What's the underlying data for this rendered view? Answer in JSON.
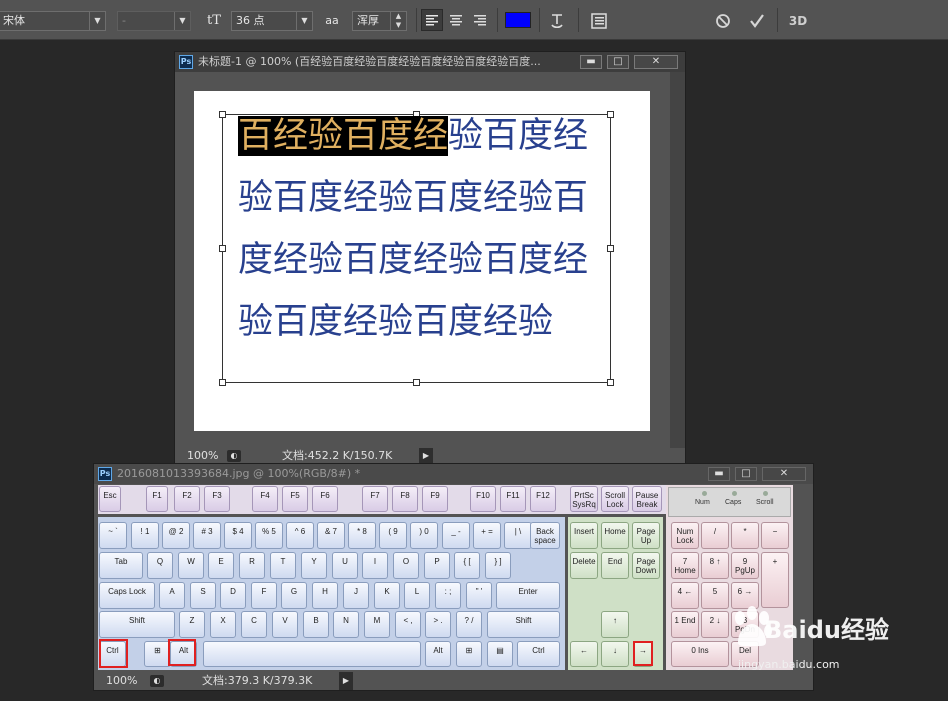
{
  "options_bar": {
    "font_family": "宋体",
    "font_style": "-",
    "size_icon": "tT",
    "font_size": "36 点",
    "aa_icon": "aa",
    "antialias": "浑厚",
    "text_color": "#0000ff",
    "icons": [
      "align-left-icon",
      "align-center-icon",
      "align-right-icon",
      "warp-text-icon",
      "panels-icon",
      "cancel-icon",
      "commit-icon",
      "3d-icon"
    ],
    "label_3d": "3D"
  },
  "doc1": {
    "title": "未标题-1 @ 100% (百经验百度经验百度经验百度经验百度经验百度...",
    "minimize": "▬",
    "maximize": "□",
    "close": "✕",
    "text_selected": "百经验百度经",
    "lines": [
      "验百度经",
      "验百度经验百度经验百",
      "度经验百度经验百度经",
      "验百度经验百度经验"
    ],
    "text_color": "#28408e",
    "selection_color": "#e0b060",
    "zoom": "100%",
    "doc_info": "文档:452.2 K/150.7K"
  },
  "doc2": {
    "title": "2016081013393684.jpg @ 100%(RGB/8#) *",
    "zoom": "100%",
    "doc_info": "文档:379.3 K/379.3K"
  },
  "keyboard": {
    "keys": [
      [
        "Esc",
        "f"
      ],
      [
        "F1",
        "f"
      ],
      [
        "F2",
        "f"
      ],
      [
        "F3",
        "f"
      ],
      [
        "F4",
        "f"
      ],
      [
        "F5",
        "f"
      ],
      [
        "F6",
        "f"
      ],
      [
        "F7",
        "f"
      ],
      [
        "F8",
        "f"
      ],
      [
        "F9",
        "f"
      ],
      [
        "F10",
        "f"
      ],
      [
        "F11",
        "f"
      ],
      [
        "F12",
        "f"
      ],
      [
        "PrtSc SysRq",
        "f"
      ],
      [
        "Scroll Lock",
        "f"
      ],
      [
        "Pause Break",
        "f"
      ],
      [
        "~ `",
        ""
      ],
      [
        "! 1",
        ""
      ],
      [
        "@ 2",
        ""
      ],
      [
        "# 3",
        ""
      ],
      [
        "$ 4",
        ""
      ],
      [
        "% 5",
        ""
      ],
      [
        "^ 6",
        ""
      ],
      [
        "& 7",
        ""
      ],
      [
        "* 8",
        ""
      ],
      [
        "( 9",
        ""
      ],
      [
        ") 0",
        ""
      ],
      [
        "_ -",
        ""
      ],
      [
        "+ =",
        ""
      ],
      [
        "| \\",
        ""
      ],
      [
        "Back space",
        ""
      ],
      [
        "Tab",
        ""
      ],
      [
        "Q",
        ""
      ],
      [
        "W",
        ""
      ],
      [
        "E",
        ""
      ],
      [
        "R",
        ""
      ],
      [
        "T",
        ""
      ],
      [
        "Y",
        ""
      ],
      [
        "U",
        ""
      ],
      [
        "I",
        ""
      ],
      [
        "O",
        ""
      ],
      [
        "P",
        ""
      ],
      [
        "{ [",
        ""
      ],
      [
        "} ]",
        ""
      ],
      [
        "Caps Lock",
        ""
      ],
      [
        "A",
        ""
      ],
      [
        "S",
        ""
      ],
      [
        "D",
        ""
      ],
      [
        "F",
        ""
      ],
      [
        "G",
        ""
      ],
      [
        "H",
        ""
      ],
      [
        "J",
        ""
      ],
      [
        "K",
        ""
      ],
      [
        "L",
        ""
      ],
      [
        ": ;",
        ""
      ],
      [
        "\" '",
        ""
      ],
      [
        "Enter",
        ""
      ],
      [
        "Shift",
        ""
      ],
      [
        "Z",
        ""
      ],
      [
        "X",
        ""
      ],
      [
        "C",
        ""
      ],
      [
        "V",
        ""
      ],
      [
        "B",
        ""
      ],
      [
        "N",
        ""
      ],
      [
        "M",
        ""
      ],
      [
        "< ,",
        ""
      ],
      [
        "> .",
        ""
      ],
      [
        "? /",
        ""
      ],
      [
        "Shift",
        ""
      ],
      [
        "Ctrl",
        ""
      ],
      [
        "⊞",
        ""
      ],
      [
        "Alt",
        ""
      ],
      [
        "",
        ""
      ],
      [
        "Alt",
        ""
      ],
      [
        "⊞",
        ""
      ],
      [
        "▤",
        ""
      ],
      [
        "Ctrl",
        ""
      ],
      [
        "Insert",
        "g"
      ],
      [
        "Home",
        "g"
      ],
      [
        "Page Up",
        "g"
      ],
      [
        "Delete",
        "g"
      ],
      [
        "End",
        "g"
      ],
      [
        "Page Down",
        "g"
      ],
      [
        "↑",
        "g"
      ],
      [
        "←",
        "g"
      ],
      [
        "↓",
        "g"
      ],
      [
        "→",
        "g"
      ],
      [
        "Num Lock",
        "p"
      ],
      [
        "/",
        "p"
      ],
      [
        "*",
        "p"
      ],
      [
        "−",
        "p"
      ],
      [
        "7 Home",
        "p"
      ],
      [
        "8 ↑",
        "p"
      ],
      [
        "9 PgUp",
        "p"
      ],
      [
        "+",
        "p"
      ],
      [
        "4 ←",
        "p"
      ],
      [
        "5",
        "p"
      ],
      [
        "6 →",
        "p"
      ],
      [
        "1 End",
        "p"
      ],
      [
        "2 ↓",
        "p"
      ],
      [
        "3 PgDn",
        "p"
      ],
      [
        "0 Ins",
        "p"
      ],
      [
        "Del",
        "p"
      ]
    ],
    "leds": [
      "Num",
      "Caps",
      "Scroll"
    ]
  },
  "watermark": {
    "brand": "Baidu经验",
    "url": "jingyan.baidu.com"
  }
}
